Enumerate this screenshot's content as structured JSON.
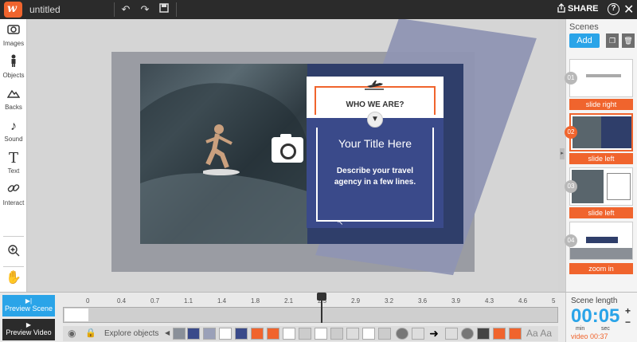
{
  "app": {
    "logo_letter": "w",
    "document_title": "untitled",
    "share_label": "SHARE",
    "help_label": "?",
    "close_label": "✕"
  },
  "toolbar": {
    "undo": "↶",
    "redo": "↷",
    "save": "💾"
  },
  "left_tools": [
    {
      "label": "Images",
      "glyph": "📷"
    },
    {
      "label": "Objects",
      "glyph": "🚶"
    },
    {
      "label": "Backs",
      "glyph": "⛰"
    },
    {
      "label": "Sound",
      "glyph": "♪"
    },
    {
      "label": "Text",
      "glyph": "T"
    },
    {
      "label": "Interact",
      "glyph": "🔗"
    }
  ],
  "left_bottom_tools": {
    "zoom_glyph": "⊕",
    "hand_glyph": "✋"
  },
  "card": {
    "heading": "WHO WE ARE?",
    "title": "Your Title Here",
    "description": "Describe your travel agency in a few lines."
  },
  "scenes_panel": {
    "title": "Scenes",
    "add_label": "Add",
    "items": [
      {
        "number": "01",
        "transition": "slide right"
      },
      {
        "number": "02",
        "transition": "slide left"
      },
      {
        "number": "03",
        "transition": "slide left"
      },
      {
        "number": "04",
        "transition": "zoom in"
      }
    ]
  },
  "bottom": {
    "preview_scene": "Preview Scene",
    "preview_video": "Preview Video",
    "explore_objects": "Explore objects",
    "aa_label": "Aa Aa",
    "ruler_ticks": [
      "0",
      "0.4",
      "0.7",
      "1.1",
      "1.4",
      "1.8",
      "2.1",
      "2.5",
      "2.9",
      "3.2",
      "3.6",
      "3.9",
      "4.3",
      "4.6",
      "5"
    ]
  },
  "scene_length": {
    "title": "Scene length",
    "value": "00:05",
    "min_label": "min",
    "sec_label": "sec",
    "video_label": "video 00:37",
    "plus": "+",
    "minus": "−"
  },
  "colors": {
    "accent_orange": "#f0642d",
    "accent_blue": "#2aa4e8",
    "card_blue": "#3a4a8a",
    "topbar": "#2b2b2b"
  }
}
